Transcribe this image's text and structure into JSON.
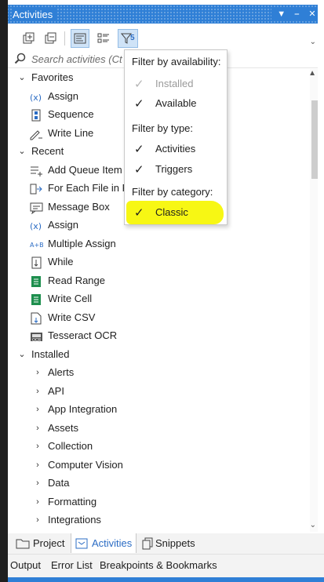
{
  "window": {
    "title": "Activities"
  },
  "search": {
    "placeholder": "Search activities (Ctrl+Alt+F)",
    "visible_text": "Search activities (Ct"
  },
  "toolbar": {
    "filter_count": "5"
  },
  "tree": [
    {
      "label": "Favorites",
      "kind": "group",
      "expanded": true
    },
    {
      "label": "Assign",
      "kind": "item",
      "icon": "variable-x-icon"
    },
    {
      "label": "Sequence",
      "kind": "item",
      "icon": "sequence-icon"
    },
    {
      "label": "Write Line",
      "kind": "item",
      "icon": "write-line-icon"
    },
    {
      "label": "Recent",
      "kind": "group",
      "expanded": true
    },
    {
      "label": "Add Queue Item",
      "kind": "item",
      "icon": "add-queue-icon"
    },
    {
      "label": "For Each File in Folder",
      "kind": "item",
      "icon": "for-each-file-icon"
    },
    {
      "label": "Message Box",
      "kind": "item",
      "icon": "message-box-icon"
    },
    {
      "label": "Assign",
      "kind": "item",
      "icon": "variable-x-icon"
    },
    {
      "label": "Multiple Assign",
      "kind": "item",
      "icon": "multiple-assign-icon"
    },
    {
      "label": "While",
      "kind": "item",
      "icon": "while-loop-icon"
    },
    {
      "label": "Read Range",
      "kind": "item",
      "icon": "excel-sheet-icon"
    },
    {
      "label": "Write Cell",
      "kind": "item",
      "icon": "excel-sheet-icon"
    },
    {
      "label": "Write CSV",
      "kind": "item",
      "icon": "csv-file-icon"
    },
    {
      "label": "Tesseract OCR",
      "kind": "item",
      "icon": "ocr-icon"
    },
    {
      "label": "Installed",
      "kind": "group",
      "expanded": true
    },
    {
      "label": "Alerts",
      "kind": "category"
    },
    {
      "label": "API",
      "kind": "category"
    },
    {
      "label": "App Integration",
      "kind": "category"
    },
    {
      "label": "Assets",
      "kind": "category"
    },
    {
      "label": "Collection",
      "kind": "category"
    },
    {
      "label": "Computer Vision",
      "kind": "category"
    },
    {
      "label": "Data",
      "kind": "category"
    },
    {
      "label": "Formatting",
      "kind": "category"
    },
    {
      "label": "Integrations",
      "kind": "category"
    }
  ],
  "filter_popup": {
    "availability_header": "Filter by availability:",
    "installed": {
      "label": "Installed",
      "checked": true,
      "disabled": true
    },
    "available": {
      "label": "Available",
      "checked": true
    },
    "type_header": "Filter by type:",
    "activities": {
      "label": "Activities",
      "checked": true
    },
    "triggers": {
      "label": "Triggers",
      "checked": true
    },
    "category_header": "Filter by category:",
    "classic": {
      "label": "Classic",
      "checked": true,
      "highlight_color": "#f6f600"
    }
  },
  "bottom_tabs": [
    {
      "label": "Project",
      "active": false
    },
    {
      "label": "Activities",
      "active": true
    },
    {
      "label": "Snippets",
      "active": false
    }
  ],
  "panel_tabs": [
    "Output",
    "Error List",
    "Breakpoints & Bookmarks"
  ],
  "colors": {
    "accent": "#2f7fd6",
    "highlight": "#f6f600",
    "active_tab_text": "#2b6cc4"
  }
}
